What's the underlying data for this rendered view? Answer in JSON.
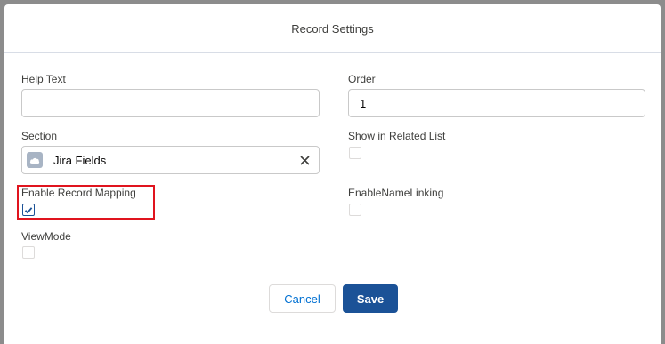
{
  "modal": {
    "title": "Record Settings"
  },
  "fields": {
    "help_text": {
      "label": "Help Text",
      "value": ""
    },
    "order": {
      "label": "Order",
      "value": "1"
    },
    "section": {
      "label": "Section",
      "value": "Jira Fields"
    },
    "show_in_related_list": {
      "label": "Show in Related List",
      "checked": false
    },
    "enable_record_mapping": {
      "label": "Enable Record Mapping",
      "checked": true
    },
    "enable_name_linking": {
      "label": "EnableNameLinking",
      "checked": false
    },
    "view_mode": {
      "label": "ViewMode",
      "checked": false
    }
  },
  "buttons": {
    "cancel": "Cancel",
    "save": "Save"
  },
  "colors": {
    "brand": "#1b5297",
    "link": "#0070d2",
    "highlight": "#e0141e"
  },
  "icons": {
    "section_pill": "cloud-icon",
    "clear": "close-icon",
    "check": "check-icon"
  }
}
